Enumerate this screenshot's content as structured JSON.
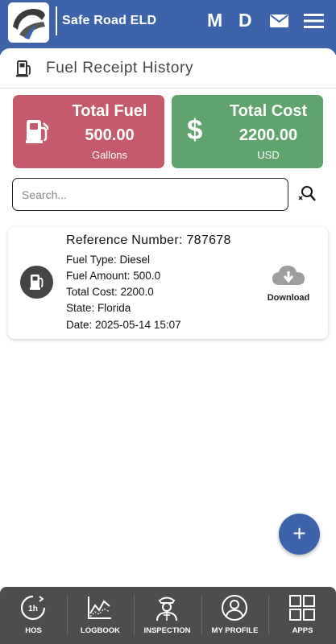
{
  "app": {
    "title": "Safe Road ELD",
    "header_letters": [
      "M",
      "D"
    ]
  },
  "page": {
    "title": "Fuel Receipt History"
  },
  "summary": {
    "fuel": {
      "title": "Total Fuel",
      "value": "500.00",
      "unit": "Gallons",
      "color": "#c45a6b"
    },
    "cost": {
      "title": "Total Cost",
      "value": "2200.00",
      "unit": "USD",
      "symbol": "$",
      "color": "#5ea46c"
    }
  },
  "search": {
    "placeholder": "Search...",
    "value": ""
  },
  "receipts": [
    {
      "reference_label": "Reference Number:",
      "reference": "787678",
      "fuel_type": "Fuel Type: Diesel",
      "fuel_amount": "Fuel Amount: 500.0",
      "total_cost": "Total Cost: 2200.0",
      "state": "State: Florida",
      "date": "Date: 2025-05-14 15:07",
      "download_label": "Download"
    }
  ],
  "fab": {
    "label": "+"
  },
  "bottom_nav": [
    {
      "label": "HOS",
      "icon": "hos-clock-icon"
    },
    {
      "label": "LOGBOOK",
      "icon": "logbook-chart-icon"
    },
    {
      "label": "INSPECTION",
      "icon": "inspector-icon"
    },
    {
      "label": "MY PROFILE",
      "icon": "profile-icon"
    },
    {
      "label": "APPS",
      "icon": "apps-grid-icon"
    }
  ],
  "colors": {
    "primary": "#3d64aa",
    "fuel_card": "#c45a6b",
    "cost_card": "#5ea46c",
    "bottom_nav": "#4d4d4d"
  }
}
